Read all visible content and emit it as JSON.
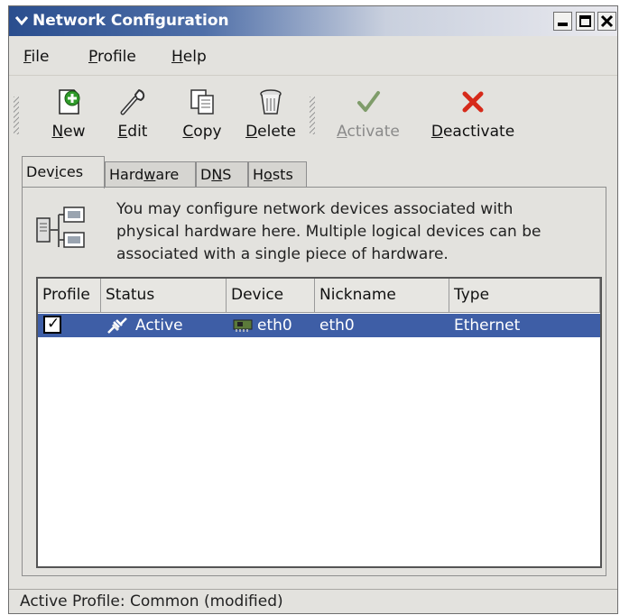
{
  "window": {
    "title": "Network Configuration"
  },
  "menu": [
    {
      "label": "File",
      "mnemonic": "F",
      "rest": "ile"
    },
    {
      "label": "Profile",
      "mnemonic": "P",
      "rest": "rofile"
    },
    {
      "label": "Help",
      "mnemonic": "H",
      "rest": "elp"
    }
  ],
  "toolbar": {
    "new": {
      "mn": "N",
      "rest": "ew"
    },
    "edit": {
      "mn": "E",
      "rest": "dit"
    },
    "copy": {
      "mn": "C",
      "rest": "opy"
    },
    "delete": {
      "mn": "D",
      "rest": "elete"
    },
    "activate": {
      "mn": "A",
      "rest": "ctivate"
    },
    "deactivate": {
      "mn": "D",
      "rest": "eactivate"
    }
  },
  "tabs": {
    "devices": {
      "pre": "Dev",
      "mn": "i",
      "post": "ces"
    },
    "hardware": {
      "pre": "Hard",
      "mn": "w",
      "post": "are"
    },
    "dns": {
      "pre": "D",
      "mn": "N",
      "post": "S"
    },
    "hosts": {
      "pre": "H",
      "mn": "o",
      "post": "sts"
    }
  },
  "info": {
    "line1": "You may configure network devices associated with",
    "line2": "physical hardware here.  Multiple logical devices can be",
    "line3": "associated with a single piece of hardware."
  },
  "columns": [
    "Profile",
    "Status",
    "Device",
    "Nickname",
    "Type"
  ],
  "devices": [
    {
      "profile": "✓",
      "status": "Active",
      "device": "eth0",
      "nickname": "eth0",
      "type": "Ethernet"
    }
  ],
  "statusbar": "Active Profile: Common (modified)",
  "colors": {
    "selection": "#3e5ea6",
    "titlebar": "#2a4e8e",
    "delete": "#d62a1a"
  },
  "icons": {
    "new": "new-document-icon",
    "edit": "wrench-icon",
    "copy": "copy-icon",
    "delete": "trash-icon",
    "activate": "checkmark-icon",
    "deactivate": "red-x-icon"
  }
}
